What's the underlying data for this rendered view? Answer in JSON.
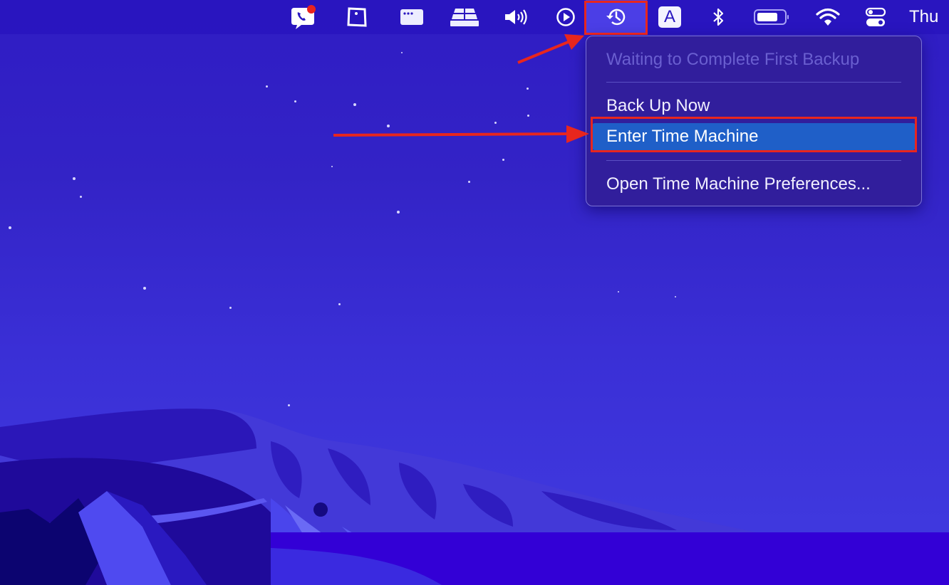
{
  "menubar": {
    "icons": [
      {
        "name": "phone-messages-icon",
        "badge": true,
        "badge_color": "#e8231f"
      },
      {
        "name": "notes-pin-icon"
      },
      {
        "name": "app-window-icon"
      },
      {
        "name": "stacked-layers-icon"
      },
      {
        "name": "volume-icon"
      },
      {
        "name": "play-circle-icon"
      },
      {
        "name": "time-machine-icon",
        "active": true
      },
      {
        "name": "input-source-icon",
        "label": "A"
      },
      {
        "name": "bluetooth-icon"
      },
      {
        "name": "battery-icon"
      },
      {
        "name": "wifi-icon"
      },
      {
        "name": "control-center-icon"
      }
    ],
    "clock": "Thu"
  },
  "time_machine_menu": {
    "status": "Waiting to Complete First Backup",
    "items": [
      {
        "label": "Back Up Now"
      },
      {
        "label": "Enter Time Machine",
        "selected": true
      },
      {
        "label": "Open Time Machine Preferences..."
      }
    ]
  },
  "annotations": {
    "color": "#e8261e",
    "highlighted": [
      "time-machine-icon",
      "Enter Time Machine"
    ]
  },
  "colors": {
    "menu_bg": "#311e9c",
    "selection": "#1f5fc8",
    "disabled_text": "#6a5fd0"
  }
}
